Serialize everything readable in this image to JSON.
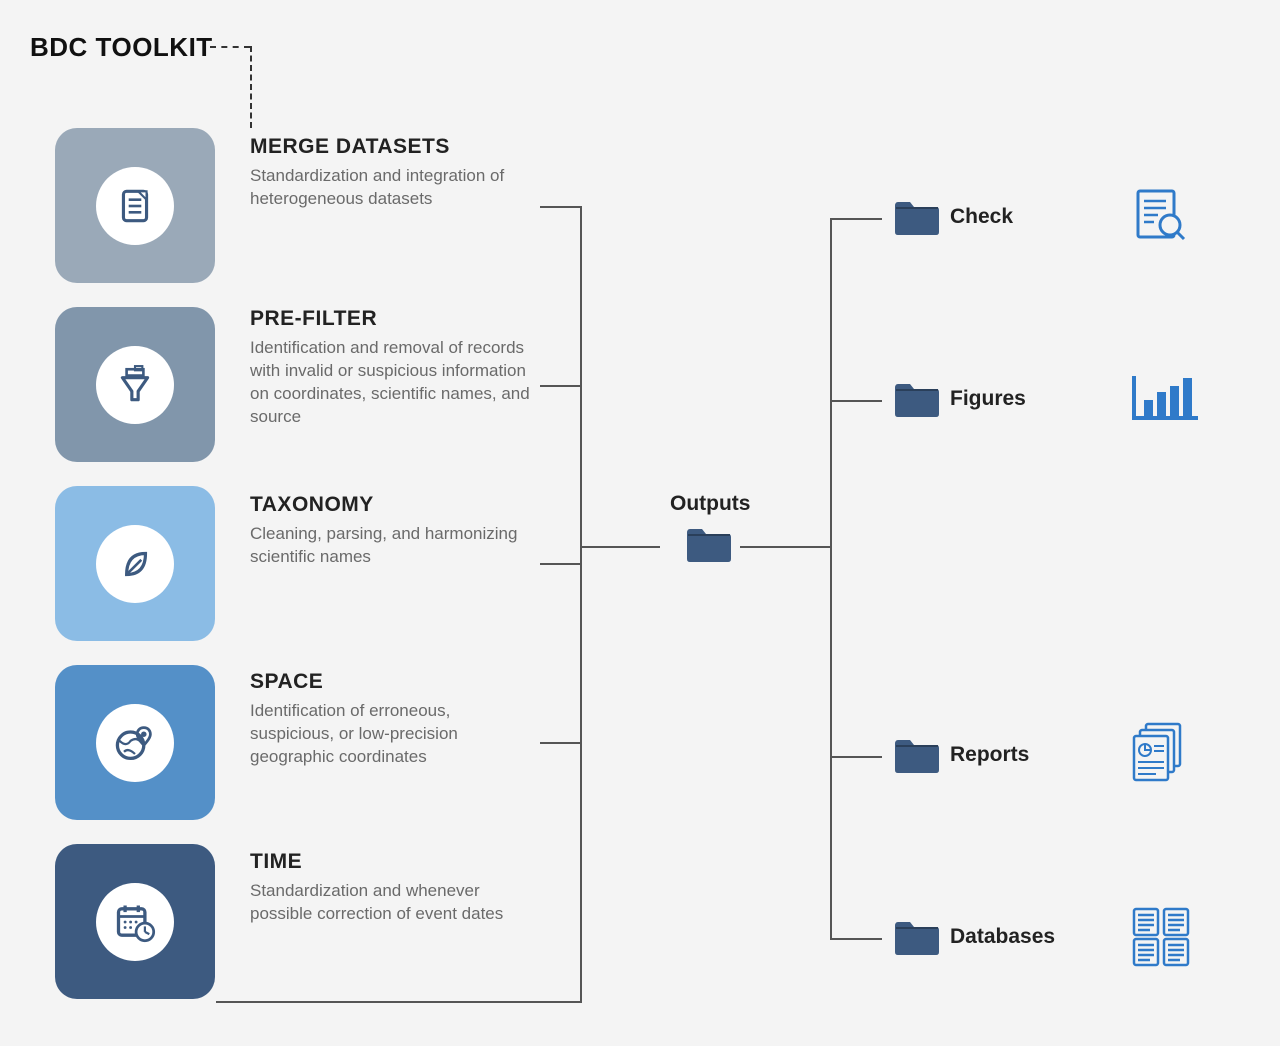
{
  "title": "BDC TOOLKIT",
  "modules": [
    {
      "name": "MERGE DATASETS",
      "desc": "Standardization and integration of heterogeneous datasets",
      "color": "#9aa9b8"
    },
    {
      "name": "PRE-FILTER",
      "desc": "Identification and removal of records with invalid or suspicious information on coordinates, scientific names, and source",
      "color": "#8196ab"
    },
    {
      "name": "TAXONOMY",
      "desc": "Cleaning, parsing, and harmonizing scientific names",
      "color": "#8bbce5"
    },
    {
      "name": "SPACE",
      "desc": "Identification of erroneous, suspicious, or low-precision geographic coordinates",
      "color": "#5490c8"
    },
    {
      "name": "TIME",
      "desc": "Standardization and whenever possible correction of event dates",
      "color": "#3d5a80"
    }
  ],
  "outputs_label": "Outputs",
  "outputs": [
    {
      "name": "Check"
    },
    {
      "name": "Figures"
    },
    {
      "name": "Reports"
    },
    {
      "name": "Databases"
    }
  ],
  "folder_color": "#3d5a80",
  "icon_color": "#2f7ac9"
}
